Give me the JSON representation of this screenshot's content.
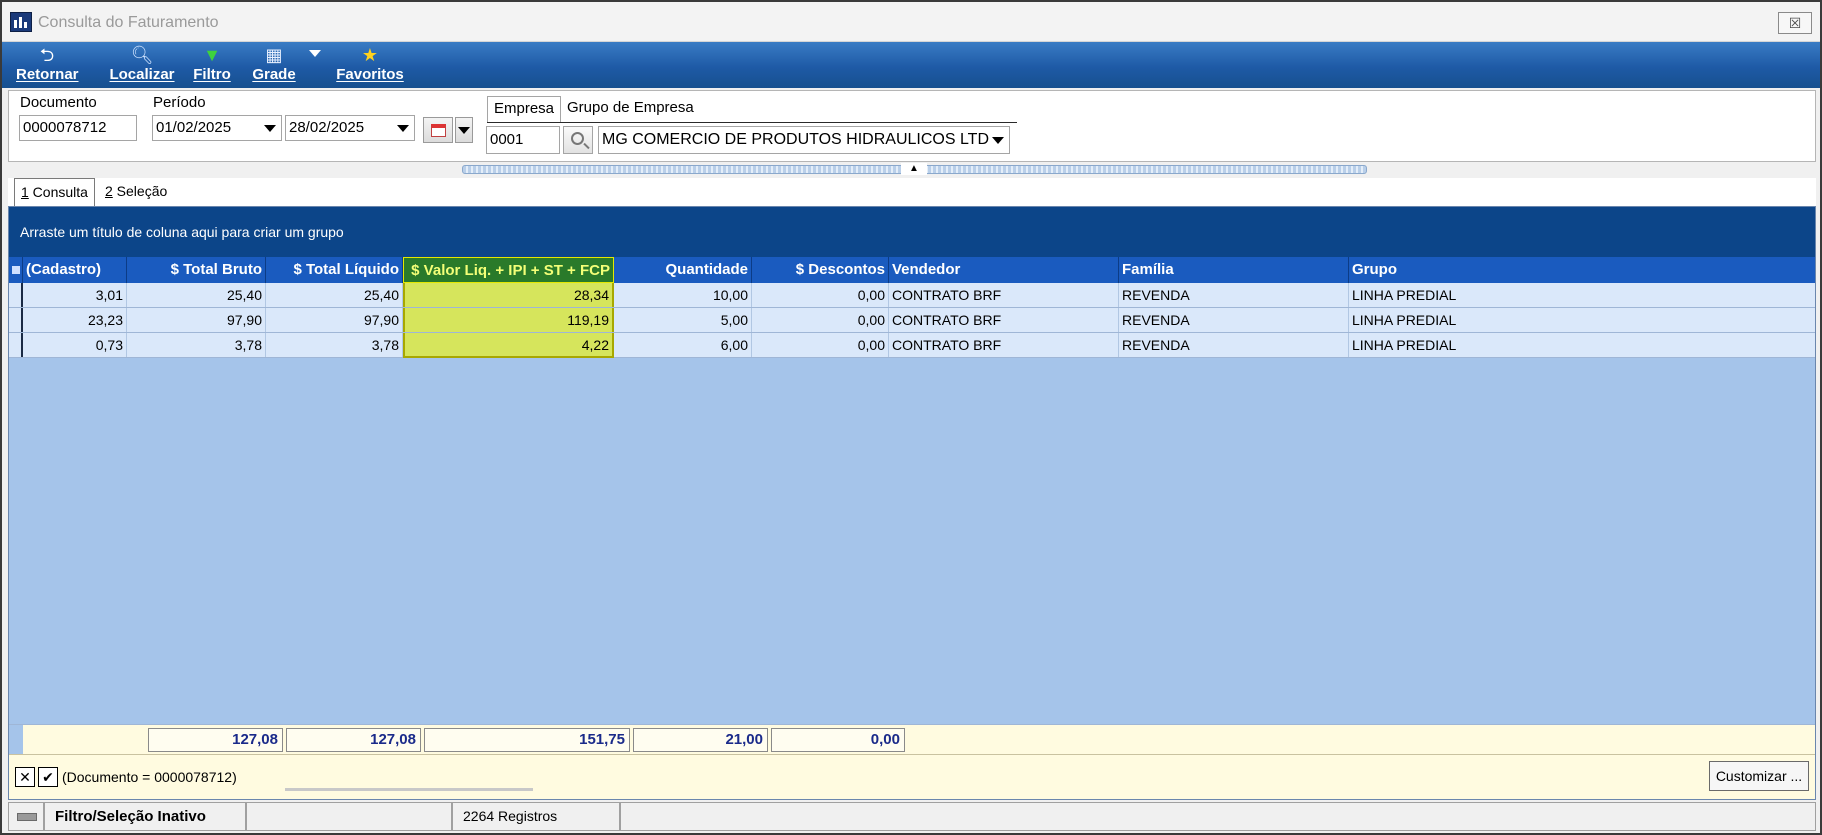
{
  "window": {
    "title": "Consulta do Faturamento",
    "close_label": "☒"
  },
  "toolbar": {
    "retornar": "Retornar",
    "localizar": "Localizar",
    "filtro": "Filtro",
    "grade": "Grade",
    "favoritos": "Favoritos"
  },
  "filters": {
    "documento_label": "Documento",
    "documento_value": "0000078712",
    "periodo_label": "Período",
    "periodo_start": "01/02/2025",
    "periodo_end": "28/02/2025",
    "empresa_tab": "Empresa",
    "grupo_tab": "Grupo de Empresa",
    "empresa_code": "0001",
    "empresa_name": "MG COMERCIO DE PRODUTOS HIDRAULICOS LTD"
  },
  "tabs": {
    "consulta_num": "1",
    "consulta_label": " Consulta",
    "selecao_num": "2",
    "selecao_label": " Seleção"
  },
  "grid": {
    "group_hint": "Arraste um título de coluna aqui para criar um grupo",
    "columns": {
      "c0": "(Cadastro)",
      "c1": "$ Total Bruto",
      "c2": "$ Total Líquido",
      "c3": "$ Valor Liq. + IPI + ST + FCP",
      "c4": "Quantidade",
      "c5": "$ Descontos",
      "c6": "Vendedor",
      "c7": "Família",
      "c8": "Grupo"
    },
    "rows": [
      {
        "c0": "3,01",
        "c1": "25,40",
        "c2": "25,40",
        "c3": "28,34",
        "c4": "10,00",
        "c5": "0,00",
        "c6": "CONTRATO BRF",
        "c7": "REVENDA",
        "c8": "LINHA PREDIAL"
      },
      {
        "c0": "23,23",
        "c1": "97,90",
        "c2": "97,90",
        "c3": "119,19",
        "c4": "5,00",
        "c5": "0,00",
        "c6": "CONTRATO BRF",
        "c7": "REVENDA",
        "c8": "LINHA PREDIAL"
      },
      {
        "c0": "0,73",
        "c1": "3,78",
        "c2": "3,78",
        "c3": "4,22",
        "c4": "6,00",
        "c5": "0,00",
        "c6": "CONTRATO BRF",
        "c7": "REVENDA",
        "c8": "LINHA PREDIAL"
      }
    ],
    "totals": {
      "c1": "127,08",
      "c2": "127,08",
      "c3": "151,75",
      "c4": "21,00",
      "c5": "0,00"
    }
  },
  "filterbar": {
    "expression": "(Documento = 0000078712)",
    "customize": "Customizar ..."
  },
  "status": {
    "filter_state": "Filtro/Seleção Inativo",
    "records": "2264 Registros"
  },
  "colors": {
    "grid_header": "#1a5bbf",
    "group_panel": "#0c4589",
    "highlight_column": "#d6e55c"
  }
}
